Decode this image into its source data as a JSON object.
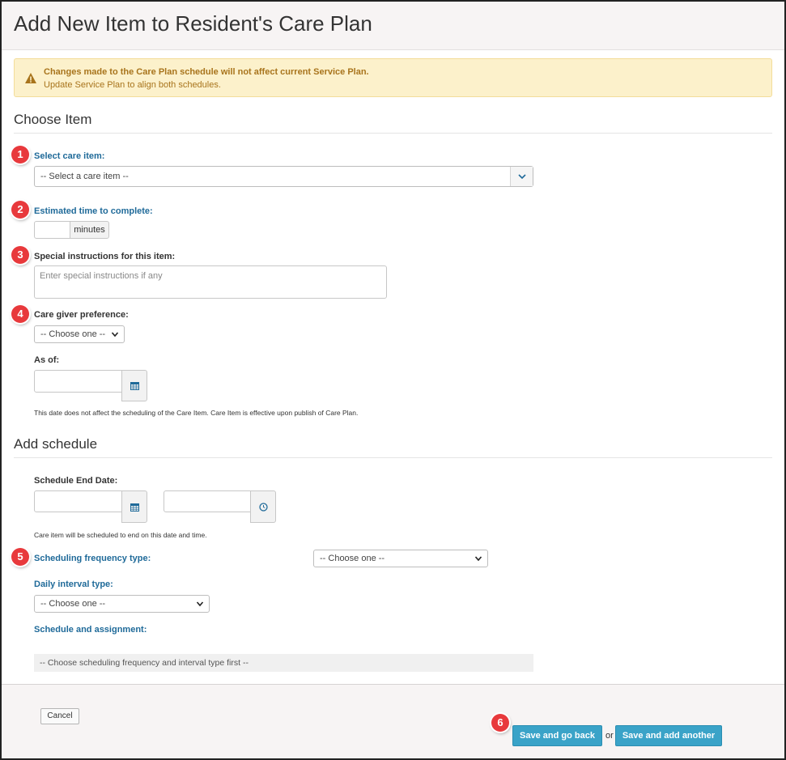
{
  "page": {
    "title": "Add New Item to Resident's Care Plan"
  },
  "alert": {
    "line1": "Changes made to the Care Plan schedule will not affect current Service Plan.",
    "line2": "Update Service Plan to align both schedules.",
    "icon": "warning-icon",
    "color": "#a8741c"
  },
  "choose_item": {
    "heading": "Choose Item",
    "care_item": {
      "label": "Select care item:",
      "value": "-- Select a care item --"
    },
    "estimated_time": {
      "label": "Estimated time to complete:",
      "value": "",
      "unit": "minutes"
    },
    "special_instructions": {
      "label": "Special instructions for this item:",
      "placeholder": "Enter special instructions if any"
    },
    "caregiver_preference": {
      "label": "Care giver preference:",
      "value": "-- Choose one --"
    },
    "as_of": {
      "label": "As of:",
      "value": "",
      "note": "This date does not affect the scheduling of the Care Item. Care Item is effective upon publish of Care Plan."
    }
  },
  "add_schedule": {
    "heading": "Add schedule",
    "end_date": {
      "label": "Schedule End Date:",
      "date_value": "",
      "time_value": "",
      "note": "Care item will be scheduled to end on this date and time."
    },
    "frequency_type": {
      "label": "Scheduling frequency type:",
      "value": "-- Choose one --"
    },
    "daily_interval": {
      "label": "Daily interval type:",
      "value": "-- Choose one --"
    },
    "assignment": {
      "label": "Schedule and assignment:",
      "placeholder": "-- Choose scheduling frequency and interval type first --"
    }
  },
  "badges": [
    "1",
    "2",
    "3",
    "4",
    "5",
    "6"
  ],
  "footer": {
    "cancel_label": "Cancel",
    "save_back_label": "Save and go back",
    "or_label": "or",
    "save_another_label": "Save and add another"
  },
  "colors": {
    "accent_blue": "#1f6a99",
    "button_primary": "#3aa3c8",
    "badge_red": "#e8393c",
    "alert_bg": "#fcf1cb"
  }
}
